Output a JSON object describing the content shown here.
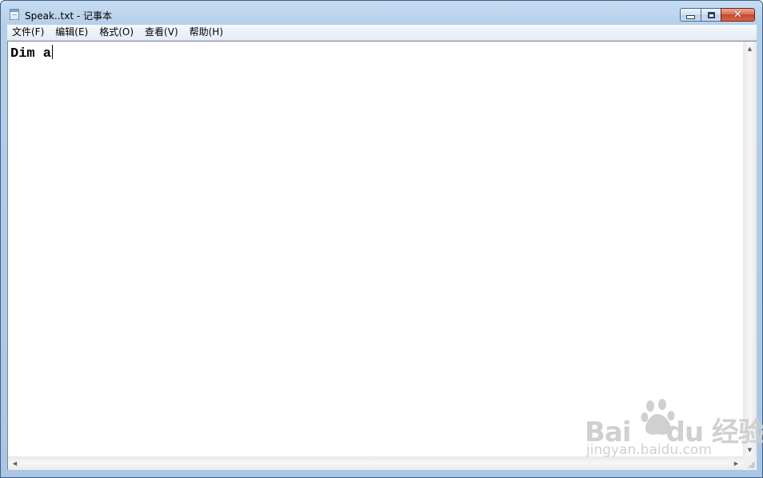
{
  "window": {
    "title": "Speak..txt - 记事本",
    "controls": {
      "minimize": "minimize",
      "maximize": "maximize",
      "close": "✕"
    }
  },
  "menu": {
    "items": [
      {
        "label": "文件(F)"
      },
      {
        "label": "编辑(E)"
      },
      {
        "label": "格式(O)"
      },
      {
        "label": "查看(V)"
      },
      {
        "label": "帮助(H)"
      }
    ]
  },
  "editor": {
    "content": "Dim a"
  },
  "scrollbar": {
    "up": "▲",
    "down": "▼",
    "left": "◀",
    "right": "▶"
  },
  "watermark": {
    "logo_left": "Bai",
    "logo_right": "du 经验",
    "url": "jingyan.baidu.com"
  },
  "icons": {
    "app": "notepad-icon",
    "minimize": "minimize-icon",
    "maximize": "maximize-icon",
    "close": "close-icon",
    "sizegrip": "size-grip-icon",
    "paw": "baidu-paw-icon"
  },
  "colors": {
    "titlebar": "#b5cfe9",
    "close_button": "#c5472b",
    "editor_bg": "#ffffff"
  }
}
